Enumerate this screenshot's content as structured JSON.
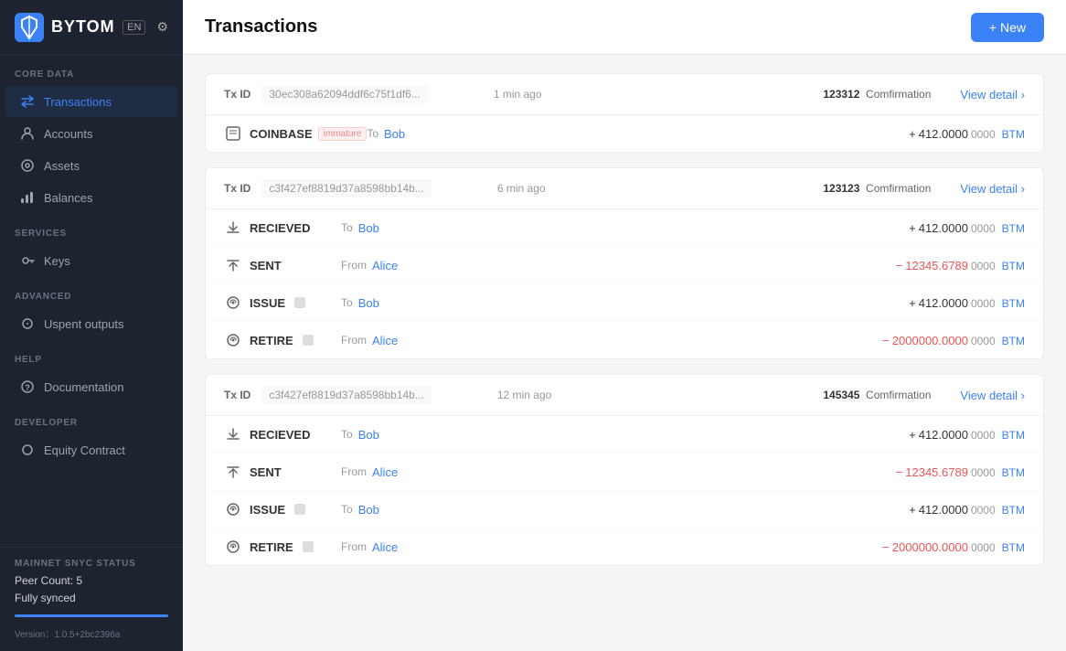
{
  "logo": {
    "text": "BYTOM",
    "lang": "EN"
  },
  "sidebar": {
    "sections": [
      {
        "label": "CORE DATA",
        "items": [
          {
            "id": "transactions",
            "label": "Transactions",
            "icon": "⇄",
            "active": true
          },
          {
            "id": "accounts",
            "label": "Accounts",
            "icon": "👤",
            "active": false
          },
          {
            "id": "assets",
            "label": "Assets",
            "icon": "◎",
            "active": false
          },
          {
            "id": "balances",
            "label": "Balances",
            "icon": "▦",
            "active": false
          }
        ]
      },
      {
        "label": "SERVICES",
        "items": [
          {
            "id": "keys",
            "label": "Keys",
            "icon": "🔑",
            "active": false
          }
        ]
      },
      {
        "label": "ADVANCED",
        "items": [
          {
            "id": "unspent",
            "label": "Uspent outputs",
            "icon": "◌",
            "active": false
          }
        ]
      },
      {
        "label": "HELP",
        "items": [
          {
            "id": "docs",
            "label": "Documentation",
            "icon": "❓",
            "active": false
          }
        ]
      },
      {
        "label": "DEVELOPER",
        "items": [
          {
            "id": "equity",
            "label": "Equity Contract",
            "icon": "⟳",
            "active": false
          }
        ]
      }
    ],
    "sync": {
      "label": "MAINNET SNYC STATUS",
      "peer_count": "Peer Count: 5",
      "status": "Fully synced"
    },
    "version": "Version：1.0.5+2bc2396a"
  },
  "header": {
    "title": "Transactions",
    "new_button": "+ New"
  },
  "transactions": [
    {
      "tx_id": "30ec308a62094ddf6c75f1df6...",
      "time": "1 min ago",
      "confirmations_num": "123312",
      "confirmations_label": "Comfirmation",
      "view_detail": "View detail",
      "rows": [
        {
          "type": "COINBASE",
          "icon": "□",
          "badge": "immature",
          "direction": "To",
          "address": "Bob",
          "sign": "+",
          "amount_int": "412.0000",
          "amount_dec": "0000",
          "currency": "BTM",
          "positive": true
        }
      ]
    },
    {
      "tx_id": "c3f427ef8819d37a8598bb14b...",
      "time": "6 min ago",
      "confirmations_num": "123123",
      "confirmations_label": "Comfirmation",
      "view_detail": "View detail",
      "rows": [
        {
          "type": "RECIEVED",
          "icon": "↑",
          "badge": null,
          "direction": "To",
          "address": "Bob",
          "sign": "+",
          "amount_int": "412.0000",
          "amount_dec": "0000",
          "currency": "BTM",
          "positive": true
        },
        {
          "type": "SENT",
          "icon": "↑",
          "badge": null,
          "direction": "From",
          "address": "Alice",
          "sign": "−",
          "amount_int": "12345.6789",
          "amount_dec": "0000",
          "currency": "BTM",
          "positive": false
        },
        {
          "type": "ISSUE",
          "icon": "⚙",
          "badge": "tag",
          "direction": "To",
          "address": "Bob",
          "sign": "+",
          "amount_int": "412.0000",
          "amount_dec": "0000",
          "currency": "BTM",
          "positive": true
        },
        {
          "type": "RETIRE",
          "icon": "⚙",
          "badge": "tag",
          "direction": "From",
          "address": "Alice",
          "sign": "−",
          "amount_int": "2000000.0000",
          "amount_dec": "0000",
          "currency": "BTM",
          "positive": false
        }
      ]
    },
    {
      "tx_id": "c3f427ef8819d37a8598bb14b...",
      "time": "12 min ago",
      "confirmations_num": "145345",
      "confirmations_label": "Comfirmation",
      "view_detail": "View detail",
      "rows": [
        {
          "type": "RECIEVED",
          "icon": "↑",
          "badge": null,
          "direction": "To",
          "address": "Bob",
          "sign": "+",
          "amount_int": "412.0000",
          "amount_dec": "0000",
          "currency": "BTM",
          "positive": true
        },
        {
          "type": "SENT",
          "icon": "↑",
          "badge": null,
          "direction": "From",
          "address": "Alice",
          "sign": "−",
          "amount_int": "12345.6789",
          "amount_dec": "0000",
          "currency": "BTM",
          "positive": false
        },
        {
          "type": "ISSUE",
          "icon": "⚙",
          "badge": "tag",
          "direction": "To",
          "address": "Bob",
          "sign": "+",
          "amount_int": "412.0000",
          "amount_dec": "0000",
          "currency": "BTM",
          "positive": true
        },
        {
          "type": "RETIRE",
          "icon": "⚙",
          "badge": "tag",
          "direction": "From",
          "address": "Alice",
          "sign": "−",
          "amount_int": "2000000.0000",
          "amount_dec": "0000",
          "currency": "BTM",
          "positive": false
        }
      ]
    }
  ]
}
